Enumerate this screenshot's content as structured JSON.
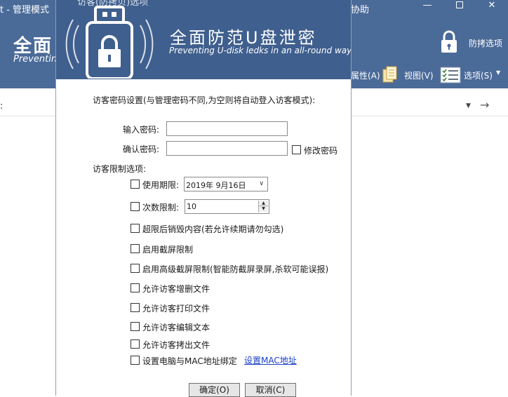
{
  "background_window": {
    "title_left": "t - 管理模式",
    "title_right": "协助",
    "brand_title": "全面",
    "brand_subtitle": "Preventing",
    "lock_button_label": "防拷选项",
    "toolbar": {
      "properties_label": "属性(A)",
      "view_label": "视图(V)",
      "options_label": "选项(S)"
    },
    "address_bar": {
      "colon": ":"
    }
  },
  "dialog": {
    "title": "访客(防拷贝)选项",
    "header_title": "全面防范U盘泄密",
    "header_subtitle": "Preventing U-disk ledks in an all-round way",
    "password_section_label": "访客密码设置(与管理密码不同,为空则将自动登入访客模式):",
    "password_label": "输入密码:",
    "password_value": "",
    "confirm_label": "确认密码:",
    "confirm_value": "",
    "modify_password_label": "修改密码",
    "modify_password_checked": false,
    "restrictions_label": "访客限制选项:",
    "options": [
      {
        "label": "使用期限:",
        "checked": false
      },
      {
        "label": "次数限制:",
        "checked": false
      },
      {
        "label": "超限后销毁内容(若允许续期请勿勾选)",
        "checked": false
      },
      {
        "label": "启用截屏限制",
        "checked": false
      },
      {
        "label": "启用高级截屏限制(智能防截屏录屏,杀软可能误报)",
        "checked": false
      },
      {
        "label": "允许访客增删文件",
        "checked": false
      },
      {
        "label": "允许访客打印文件",
        "checked": false
      },
      {
        "label": "允许访客编辑文本",
        "checked": false
      },
      {
        "label": "允许访客拷出文件",
        "checked": false
      },
      {
        "label": "设置电脑与MAC地址绑定",
        "checked": false
      }
    ],
    "expiry_date": "2019年  9月16日",
    "count_value": "10",
    "mac_link_label": "设置MAC地址",
    "ok_label": "确定(O)",
    "cancel_label": "取消(C)"
  },
  "colors": {
    "header_blue": "#4a6a98",
    "dialog_header_blue": "#3f5f8e",
    "link_blue": "#1a3ec8"
  }
}
